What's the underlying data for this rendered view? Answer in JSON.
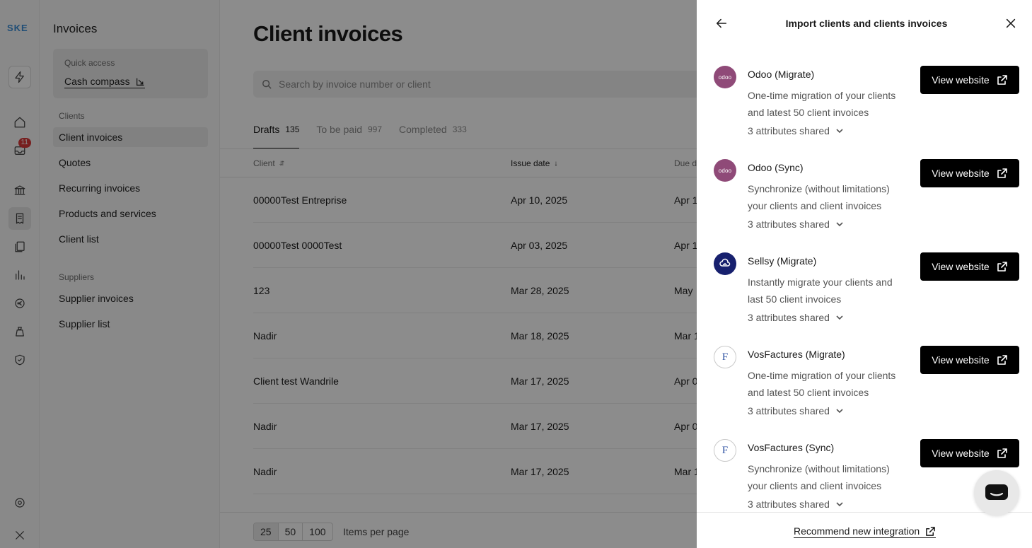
{
  "app": {
    "logo_text": "SKE",
    "inbox_badge": "11"
  },
  "sidebar": {
    "title": "Invoices",
    "quick_access": {
      "label": "Quick access",
      "link": "Cash compass"
    },
    "clients_label": "Clients",
    "client_items": [
      "Client invoices",
      "Quotes",
      "Recurring invoices",
      "Products and services",
      "Client list"
    ],
    "suppliers_label": "Suppliers",
    "supplier_items": [
      "Supplier invoices",
      "Supplier list"
    ]
  },
  "main": {
    "title": "Client invoices",
    "search_placeholder": "Search by invoice number or client",
    "tabs": [
      {
        "label": "Drafts",
        "count": "135"
      },
      {
        "label": "To be paid",
        "count": "997"
      },
      {
        "label": "Completed",
        "count": "333"
      }
    ],
    "columns": {
      "client": "Client",
      "issue_date": "Issue date",
      "due_date": "Due d"
    },
    "rows": [
      {
        "client": "00000Test Entreprise",
        "issue": "Apr 10, 2025",
        "due": "Apr 1"
      },
      {
        "client": "00000Test 0000Test",
        "issue": "Apr 03, 2025",
        "due": "Apr 1"
      },
      {
        "client": "123",
        "issue": "Mar 28, 2025",
        "due": "May"
      },
      {
        "client": "Nadir",
        "issue": "Mar 18, 2025",
        "due": "Mar 1"
      },
      {
        "client": "Client test Wandrile",
        "issue": "Mar 17, 2025",
        "due": "Apr 0"
      },
      {
        "client": "Nadir",
        "issue": "Mar 17, 2025",
        "due": "Apr 0"
      },
      {
        "client": "Nadir",
        "issue": "Mar 17, 2025",
        "due": "Mar 1"
      }
    ],
    "pager": [
      "25",
      "50",
      "100"
    ],
    "items_per_page": "Items per page"
  },
  "drawer": {
    "title": "Import clients and clients invoices",
    "view_website_label": "View website",
    "integrations": [
      {
        "name": "Odoo (Migrate)",
        "logo": "odoo",
        "logo_text": "odoo",
        "desc": "One-time migration of your clients and latest 50 client invoices",
        "attrs": "3 attributes shared"
      },
      {
        "name": "Odoo (Sync)",
        "logo": "odoo",
        "logo_text": "odoo",
        "desc": "Synchronize (without limitations) your clients and client invoices",
        "attrs": "3 attributes shared"
      },
      {
        "name": "Sellsy (Migrate)",
        "logo": "sellsy",
        "logo_text": "",
        "desc": "Instantly migrate your clients and last 50 client invoices",
        "attrs": "3 attributes shared"
      },
      {
        "name": "VosFactures (Migrate)",
        "logo": "vosfactures",
        "logo_text": "F",
        "desc": "One-time migration of your clients and latest 50 client invoices",
        "attrs": "3 attributes shared"
      },
      {
        "name": "VosFactures (Sync)",
        "logo": "vosfactures",
        "logo_text": "F",
        "desc": "Synchronize (without limitations) your clients and client invoices",
        "attrs": "3 attributes shared"
      }
    ],
    "footer_link": "Recommend new integration"
  },
  "colors": {
    "primary_button": "#000000",
    "odoo_brand": "#8f4a78",
    "sellsy_brand": "#17206e",
    "badge": "#d93a3a"
  }
}
